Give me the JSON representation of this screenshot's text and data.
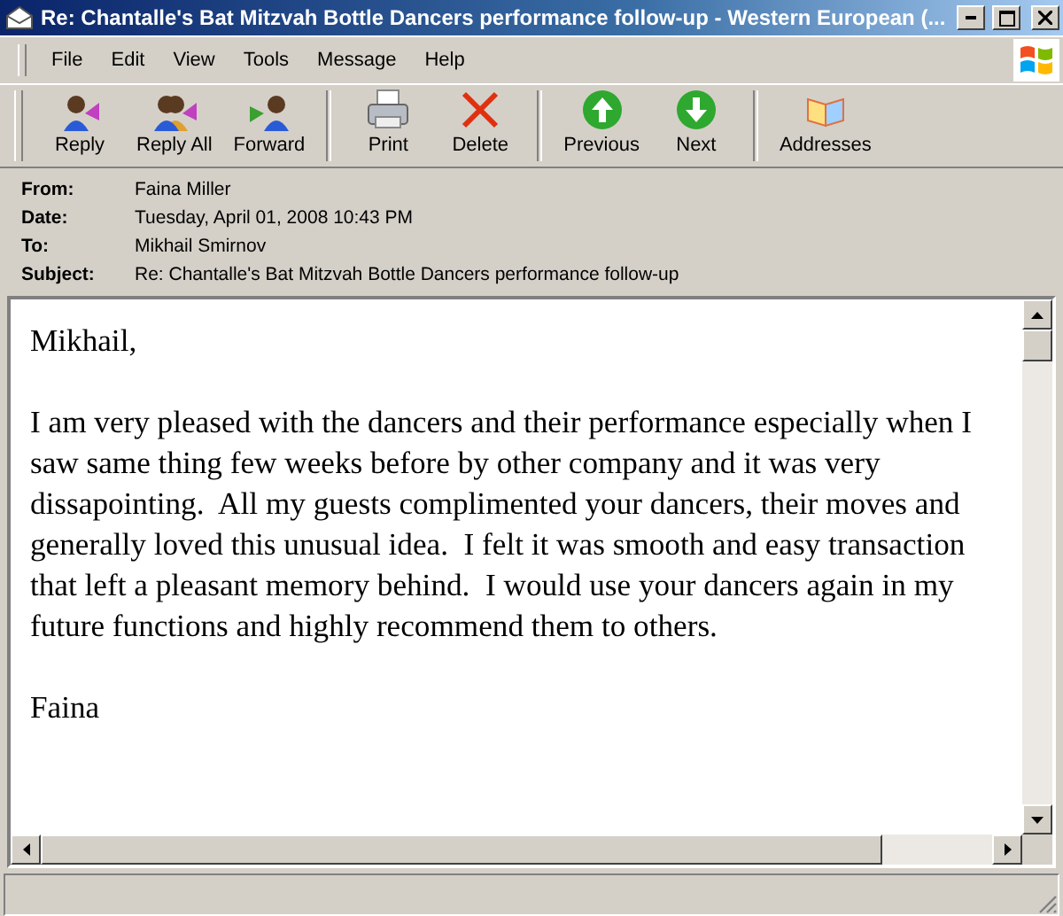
{
  "window": {
    "title": "Re: Chantalle's Bat Mitzvah Bottle Dancers performance follow-up - Western European (..."
  },
  "menu": [
    "File",
    "Edit",
    "View",
    "Tools",
    "Message",
    "Help"
  ],
  "toolbar": [
    {
      "kind": "reply",
      "label": "Reply"
    },
    {
      "kind": "reply-all",
      "label": "Reply All"
    },
    {
      "kind": "forward",
      "label": "Forward"
    },
    {
      "kind": "separator"
    },
    {
      "kind": "print",
      "label": "Print"
    },
    {
      "kind": "delete",
      "label": "Delete"
    },
    {
      "kind": "separator"
    },
    {
      "kind": "previous",
      "label": "Previous"
    },
    {
      "kind": "next",
      "label": "Next"
    },
    {
      "kind": "separator"
    },
    {
      "kind": "addresses",
      "label": "Addresses"
    }
  ],
  "header": [
    {
      "label": "From:",
      "value": "Faina Miller"
    },
    {
      "label": "Date:",
      "value": "Tuesday, April 01, 2008 10:43 PM"
    },
    {
      "label": "To:",
      "value": "Mikhail Smirnov"
    },
    {
      "label": "Subject:",
      "value": "Re: Chantalle's Bat Mitzvah Bottle Dancers performance follow-up"
    }
  ],
  "body": [
    "Mikhail,",
    "I am very pleased with the dancers and their performance especially when I saw same thing few weeks before by other company and it was very dissapointing.  All my guests complimented your dancers, their moves and generally loved this unusual idea.  I felt it was smooth and easy transaction that left a pleasant memory behind.  I would use your dancers again in my future functions and highly recommend them to others.",
    "Faina"
  ]
}
